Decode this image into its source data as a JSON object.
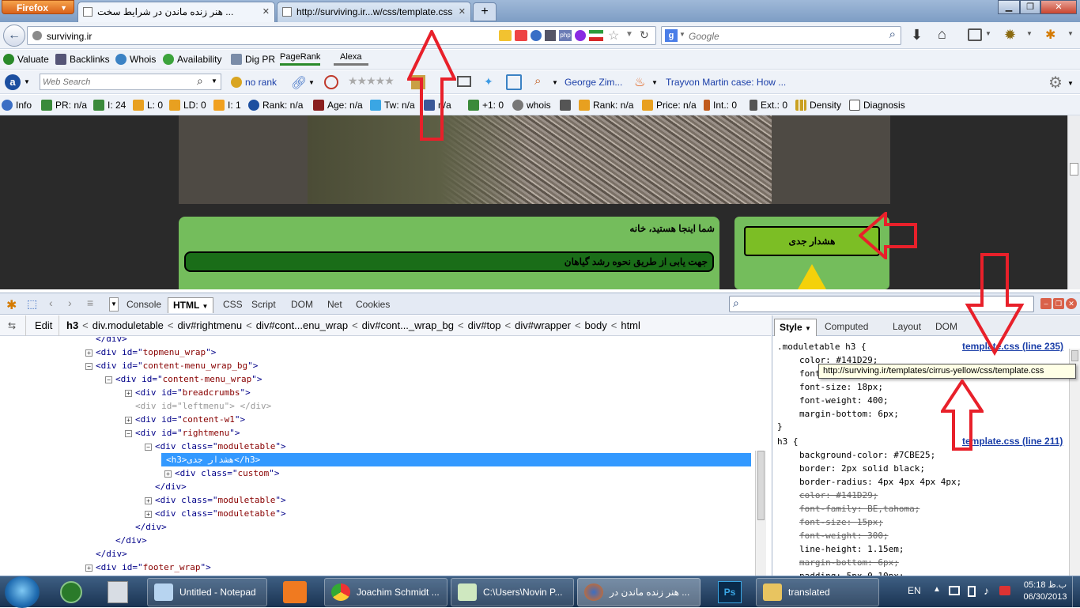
{
  "browser": {
    "app_button": "Firefox",
    "tabs": [
      {
        "label": "هنر زنده ماندن در شرایط سخت ...",
        "active": true
      },
      {
        "label": "http://surviving.ir...w/css/template.css",
        "active": false
      }
    ],
    "new_tab_label": "+",
    "url": "surviving.ir",
    "search_placeholder": "Google"
  },
  "seo_toolbar": {
    "items": [
      "Valuate",
      "Backlinks",
      "Whois",
      "Availability",
      "Dig PR",
      "PageRank",
      "Alexa"
    ]
  },
  "search_toolbar": {
    "web_search_placeholder": "Web Search",
    "rank": "no rank",
    "news1": "George Zim...",
    "news2": "Trayvon Martin case: How ..."
  },
  "info_toolbar": {
    "items": [
      "Info",
      "PR: n/a",
      "I: 24",
      "L: 0",
      "LD: 0",
      "I: 1",
      "Rank: n/a",
      "Age: n/a",
      "Tw: n/a",
      "n/a",
      "+1: 0",
      "whois",
      "Rank: n/a",
      "Price: n/a",
      "Int.: 0",
      "Ext.: 0",
      "Density",
      "Diagnosis"
    ]
  },
  "webpage": {
    "breadcrumb": "شما اینجا هستید، خانه",
    "article_heading": "جهت یابی از طریق نحوه رشد گیاهان",
    "module_heading": "هشدار جدی"
  },
  "firebug": {
    "tabs": [
      "Console",
      "HTML",
      "CSS",
      "Script",
      "DOM",
      "Net",
      "Cookies"
    ],
    "active_tab": "HTML",
    "edit_label": "Edit",
    "crumbs": [
      "h3",
      "div.moduletable",
      "div#rightmenu",
      "div#cont...enu_wrap",
      "div#cont..._wrap_bg",
      "div#top",
      "div#wrapper",
      "body",
      "html"
    ],
    "tree": [
      {
        "indent": 0,
        "toggle": "",
        "tag": "</div>"
      },
      {
        "indent": 0,
        "toggle": "+",
        "tag": "<div",
        "attr": "id",
        "value": "topmenu_wrap"
      },
      {
        "indent": 0,
        "toggle": "-",
        "tag": "<div",
        "attr": "id",
        "value": "content-menu_wrap_bg"
      },
      {
        "indent": 1,
        "toggle": "-",
        "tag": "<div",
        "attr": "id",
        "value": "content-menu_wrap"
      },
      {
        "indent": 2,
        "toggle": "+",
        "tag": "<div",
        "attr": "id",
        "value": "breadcrumbs"
      },
      {
        "indent": 2,
        "toggle": "",
        "tag": "<div",
        "attr": "id",
        "value": "leftmenu",
        "dim": true
      },
      {
        "indent": 2,
        "toggle": "+",
        "tag": "<div",
        "attr": "id",
        "value": "content-w1"
      },
      {
        "indent": 2,
        "toggle": "-",
        "tag": "<div",
        "attr": "id",
        "value": "rightmenu"
      },
      {
        "indent": 3,
        "toggle": "-",
        "tag": "<div",
        "attr": "class",
        "value": "moduletable"
      },
      {
        "indent": 4,
        "toggle": "",
        "selected": true,
        "text": "<h3>هشدار جدی</h3>"
      },
      {
        "indent": 4,
        "toggle": "+",
        "tag": "<div",
        "attr": "class",
        "value": "custom"
      },
      {
        "indent": 3,
        "toggle": "",
        "tag": "</div>"
      },
      {
        "indent": 3,
        "toggle": "+",
        "tag": "<div",
        "attr": "class",
        "value": "moduletable"
      },
      {
        "indent": 3,
        "toggle": "+",
        "tag": "<div",
        "attr": "class",
        "value": "moduletable"
      },
      {
        "indent": 2,
        "toggle": "",
        "tag": "</div>"
      },
      {
        "indent": 1,
        "toggle": "",
        "tag": "</div>"
      },
      {
        "indent": 0,
        "toggle": "",
        "tag": "</div>"
      },
      {
        "indent": 0,
        "toggle": "+",
        "tag": "<div",
        "attr": "id",
        "value": "footer_wrap"
      }
    ],
    "side_tabs": [
      "Style",
      "Computed",
      "Layout",
      "DOM"
    ],
    "rule1": {
      "selector": ".moduletable h3 {",
      "source": "template.css (line 235)",
      "props": [
        "color: #141D29;",
        "font-family: BE,tahoma;",
        "font-size: 18px;",
        "font-weight: 400;",
        "margin-bottom: 6px;"
      ],
      "close": "}"
    },
    "tooltip": "http://surviving.ir/templates/cirrus-yellow/css/template.css",
    "rule2": {
      "selector": "h3 {",
      "source": "template.css (line 211)",
      "props": [
        {
          "text": "background-color: #7CBE25;",
          "over": false
        },
        {
          "text": "border: 2px solid black;",
          "over": false
        },
        {
          "text": "border-radius: 4px 4px 4px 4px;",
          "over": false
        },
        {
          "text": "color: #141D29;",
          "over": true
        },
        {
          "text": "font-family: BE,tahoma;",
          "over": true
        },
        {
          "text": "font-size: 15px;",
          "over": true
        },
        {
          "text": "font-weight: 300;",
          "over": true
        },
        {
          "text": "line-height: 1.15em;",
          "over": false
        },
        {
          "text": "margin-bottom: 6px;",
          "over": true
        },
        {
          "text": "padding: 5px 0 10px;",
          "over": false
        }
      ]
    }
  },
  "taskbar": {
    "items": [
      "Untitled - Notepad",
      "Joachim Schmidt ...",
      "C:\\Users\\Novin P...",
      "هنر زنده ماندن در ...",
      "translated"
    ],
    "lang": "EN",
    "time": "05:18 ب.ظ",
    "date": "06/30/2013"
  },
  "colors": {
    "accent_green": "#7CBE25",
    "selection_blue": "#3399ff",
    "annotation_red": "#e8202a"
  }
}
